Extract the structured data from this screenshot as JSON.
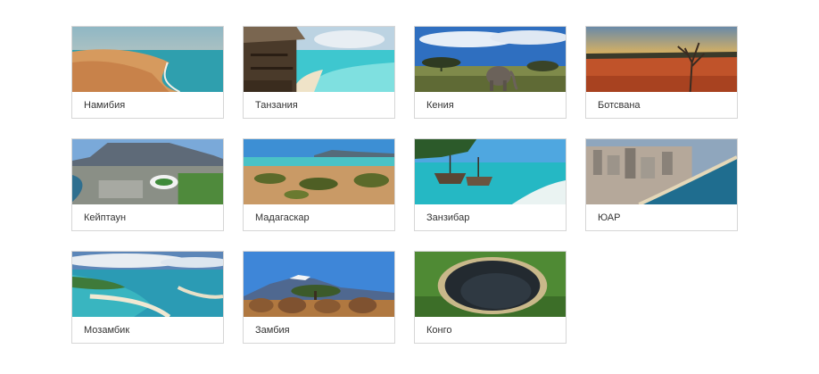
{
  "destinations": [
    {
      "label": "Намибия",
      "image": "desert-dunes-ocean"
    },
    {
      "label": "Танзания",
      "image": "tropical-beach-resort"
    },
    {
      "label": "Кения",
      "image": "savanna-elephant"
    },
    {
      "label": "Ботсвана",
      "image": "savanna-lone-tree"
    },
    {
      "label": "Кейптаун",
      "image": "city-stadium-mountain"
    },
    {
      "label": "Мадагаскар",
      "image": "coastal-scrubland"
    },
    {
      "label": "Занзибар",
      "image": "boats-turquoise-sea"
    },
    {
      "label": "ЮАР",
      "image": "coastal-city-beach"
    },
    {
      "label": "Мозамбик",
      "image": "sandbanks-lagoon"
    },
    {
      "label": "Замбия",
      "image": "elephant-herd-kilimanjaro"
    },
    {
      "label": "Конго",
      "image": "crater-sinkhole"
    }
  ]
}
